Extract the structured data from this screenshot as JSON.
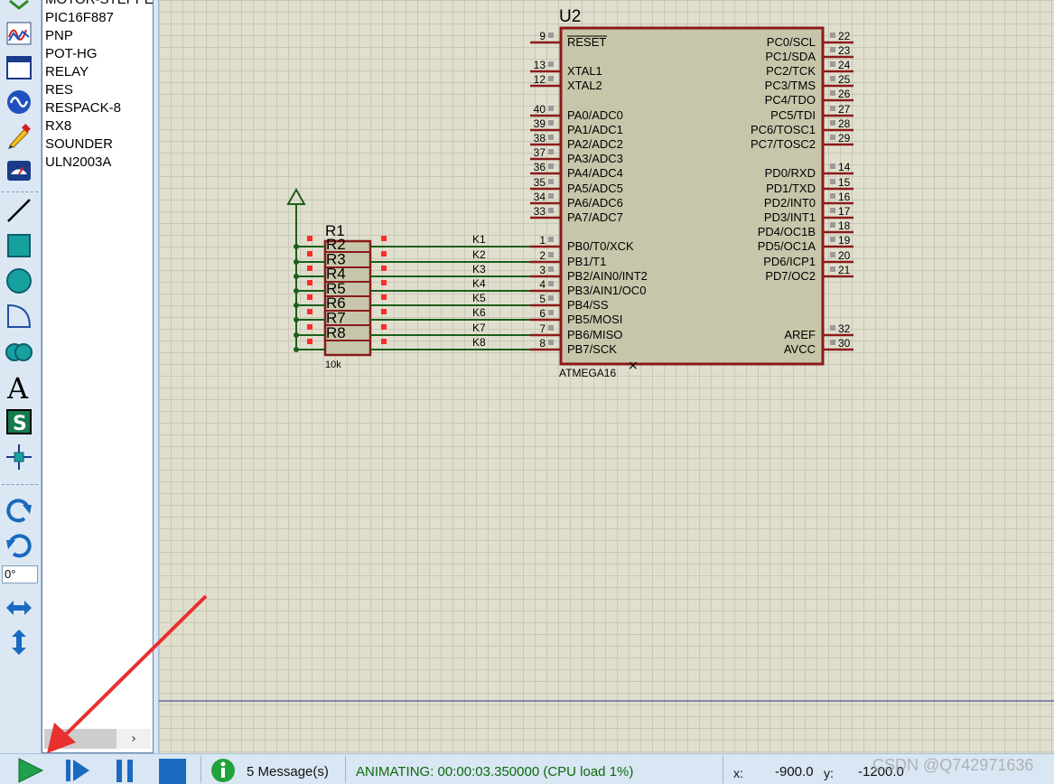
{
  "device_list": {
    "items": [
      "MOTOR-STEPPER",
      "PIC16F887",
      "PNP",
      "POT-HG",
      "RELAY",
      "RES",
      "RESPACK-8",
      "RX8",
      "SOUNDER",
      "ULN2003A"
    ]
  },
  "tools": {
    "rotation_value": "0°"
  },
  "schematic": {
    "mcu_ref": "U2",
    "mcu_part": "ATMEGA16",
    "respack_ref": "R1",
    "respack_value": "10k",
    "respack_sub_refs": [
      "R2",
      "R3",
      "R4",
      "R5",
      "R6",
      "R7",
      "R8"
    ],
    "left_pins": [
      {
        "num": "9",
        "name": "RESET",
        "overline": true
      },
      {
        "num": "13",
        "name": "XTAL1"
      },
      {
        "num": "12",
        "name": "XTAL2"
      },
      {
        "num": "40",
        "name": "PA0/ADC0"
      },
      {
        "num": "39",
        "name": "PA1/ADC1"
      },
      {
        "num": "38",
        "name": "PA2/ADC2"
      },
      {
        "num": "37",
        "name": "PA3/ADC3"
      },
      {
        "num": "36",
        "name": "PA4/ADC4"
      },
      {
        "num": "35",
        "name": "PA5/ADC5"
      },
      {
        "num": "34",
        "name": "PA6/ADC6"
      },
      {
        "num": "33",
        "name": "PA7/ADC7"
      },
      {
        "num": "1",
        "name": "PB0/T0/XCK"
      },
      {
        "num": "2",
        "name": "PB1/T1"
      },
      {
        "num": "3",
        "name": "PB2/AIN0/INT2"
      },
      {
        "num": "4",
        "name": "PB3/AIN1/OC0"
      },
      {
        "num": "5",
        "name": "PB4/SS"
      },
      {
        "num": "6",
        "name": "PB5/MOSI"
      },
      {
        "num": "7",
        "name": "PB6/MISO"
      },
      {
        "num": "8",
        "name": "PB7/SCK"
      }
    ],
    "right_pins": [
      {
        "num": "22",
        "name": "PC0/SCL"
      },
      {
        "num": "23",
        "name": "PC1/SDA"
      },
      {
        "num": "24",
        "name": "PC2/TCK"
      },
      {
        "num": "25",
        "name": "PC3/TMS"
      },
      {
        "num": "26",
        "name": "PC4/TDO"
      },
      {
        "num": "27",
        "name": "PC5/TDI"
      },
      {
        "num": "28",
        "name": "PC6/TOSC1"
      },
      {
        "num": "29",
        "name": "PC7/TOSC2"
      },
      {
        "num": "14",
        "name": "PD0/RXD"
      },
      {
        "num": "15",
        "name": "PD1/TXD"
      },
      {
        "num": "16",
        "name": "PD2/INT0"
      },
      {
        "num": "17",
        "name": "PD3/INT1"
      },
      {
        "num": "18",
        "name": "PD4/OC1B"
      },
      {
        "num": "19",
        "name": "PD5/OC1A"
      },
      {
        "num": "20",
        "name": "PD6/ICP1"
      },
      {
        "num": "21",
        "name": "PD7/OC2"
      },
      {
        "num": "32",
        "name": "AREF"
      },
      {
        "num": "30",
        "name": "AVCC"
      }
    ],
    "net_labels": [
      "K1",
      "K2",
      "K3",
      "K4",
      "K5",
      "K6",
      "K7",
      "K8"
    ]
  },
  "statusbar": {
    "messages": "5 Message(s)",
    "animating": "ANIMATING: 00:00:03.350000 (CPU load 1%)",
    "x_label": "x:",
    "x_value": "-900.0",
    "y_label": "y:",
    "y_value": "-1200.0",
    "watermark": "CSDN @Q742971636"
  },
  "colors": {
    "component_outline": "#8b1a1a",
    "component_fill": "#c8c6aa",
    "wire": "#1b5e1b",
    "pin_marker": "#ff2a2a",
    "arrow": "#e8302e"
  }
}
